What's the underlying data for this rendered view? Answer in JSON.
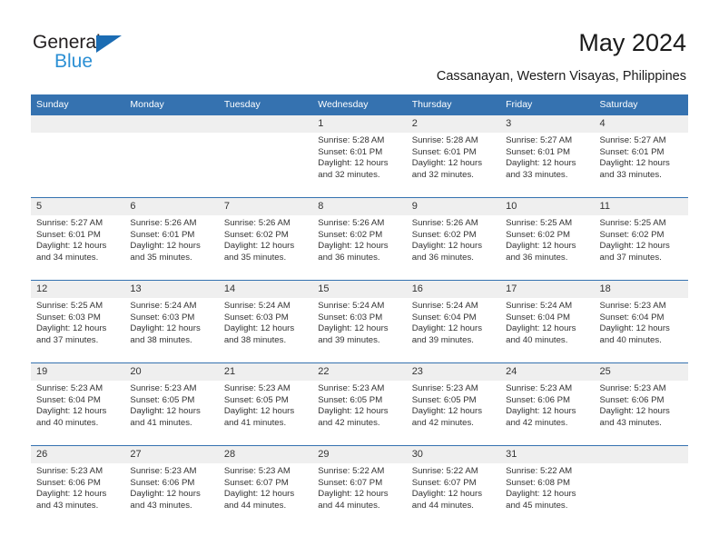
{
  "brand": {
    "name_top": "General",
    "name_bottom": "Blue",
    "accent_dark_blue": "#1b6cb3",
    "accent_light_blue": "#2b8fd4"
  },
  "header": {
    "title": "May 2024",
    "subtitle": "Cassanayan, Western Visayas, Philippines"
  },
  "theme": {
    "header_blue": "#3572b0",
    "daynum_gray": "#efefef",
    "text": "#333333"
  },
  "calendar": {
    "weekday_headers": [
      "Sunday",
      "Monday",
      "Tuesday",
      "Wednesday",
      "Thursday",
      "Friday",
      "Saturday"
    ],
    "weeks": [
      [
        {
          "day": "",
          "lines": []
        },
        {
          "day": "",
          "lines": []
        },
        {
          "day": "",
          "lines": []
        },
        {
          "day": "1",
          "lines": [
            "Sunrise: 5:28 AM",
            "Sunset: 6:01 PM",
            "Daylight: 12 hours",
            "and 32 minutes."
          ]
        },
        {
          "day": "2",
          "lines": [
            "Sunrise: 5:28 AM",
            "Sunset: 6:01 PM",
            "Daylight: 12 hours",
            "and 32 minutes."
          ]
        },
        {
          "day": "3",
          "lines": [
            "Sunrise: 5:27 AM",
            "Sunset: 6:01 PM",
            "Daylight: 12 hours",
            "and 33 minutes."
          ]
        },
        {
          "day": "4",
          "lines": [
            "Sunrise: 5:27 AM",
            "Sunset: 6:01 PM",
            "Daylight: 12 hours",
            "and 33 minutes."
          ]
        }
      ],
      [
        {
          "day": "5",
          "lines": [
            "Sunrise: 5:27 AM",
            "Sunset: 6:01 PM",
            "Daylight: 12 hours",
            "and 34 minutes."
          ]
        },
        {
          "day": "6",
          "lines": [
            "Sunrise: 5:26 AM",
            "Sunset: 6:01 PM",
            "Daylight: 12 hours",
            "and 35 minutes."
          ]
        },
        {
          "day": "7",
          "lines": [
            "Sunrise: 5:26 AM",
            "Sunset: 6:02 PM",
            "Daylight: 12 hours",
            "and 35 minutes."
          ]
        },
        {
          "day": "8",
          "lines": [
            "Sunrise: 5:26 AM",
            "Sunset: 6:02 PM",
            "Daylight: 12 hours",
            "and 36 minutes."
          ]
        },
        {
          "day": "9",
          "lines": [
            "Sunrise: 5:26 AM",
            "Sunset: 6:02 PM",
            "Daylight: 12 hours",
            "and 36 minutes."
          ]
        },
        {
          "day": "10",
          "lines": [
            "Sunrise: 5:25 AM",
            "Sunset: 6:02 PM",
            "Daylight: 12 hours",
            "and 36 minutes."
          ]
        },
        {
          "day": "11",
          "lines": [
            "Sunrise: 5:25 AM",
            "Sunset: 6:02 PM",
            "Daylight: 12 hours",
            "and 37 minutes."
          ]
        }
      ],
      [
        {
          "day": "12",
          "lines": [
            "Sunrise: 5:25 AM",
            "Sunset: 6:03 PM",
            "Daylight: 12 hours",
            "and 37 minutes."
          ]
        },
        {
          "day": "13",
          "lines": [
            "Sunrise: 5:24 AM",
            "Sunset: 6:03 PM",
            "Daylight: 12 hours",
            "and 38 minutes."
          ]
        },
        {
          "day": "14",
          "lines": [
            "Sunrise: 5:24 AM",
            "Sunset: 6:03 PM",
            "Daylight: 12 hours",
            "and 38 minutes."
          ]
        },
        {
          "day": "15",
          "lines": [
            "Sunrise: 5:24 AM",
            "Sunset: 6:03 PM",
            "Daylight: 12 hours",
            "and 39 minutes."
          ]
        },
        {
          "day": "16",
          "lines": [
            "Sunrise: 5:24 AM",
            "Sunset: 6:04 PM",
            "Daylight: 12 hours",
            "and 39 minutes."
          ]
        },
        {
          "day": "17",
          "lines": [
            "Sunrise: 5:24 AM",
            "Sunset: 6:04 PM",
            "Daylight: 12 hours",
            "and 40 minutes."
          ]
        },
        {
          "day": "18",
          "lines": [
            "Sunrise: 5:23 AM",
            "Sunset: 6:04 PM",
            "Daylight: 12 hours",
            "and 40 minutes."
          ]
        }
      ],
      [
        {
          "day": "19",
          "lines": [
            "Sunrise: 5:23 AM",
            "Sunset: 6:04 PM",
            "Daylight: 12 hours",
            "and 40 minutes."
          ]
        },
        {
          "day": "20",
          "lines": [
            "Sunrise: 5:23 AM",
            "Sunset: 6:05 PM",
            "Daylight: 12 hours",
            "and 41 minutes."
          ]
        },
        {
          "day": "21",
          "lines": [
            "Sunrise: 5:23 AM",
            "Sunset: 6:05 PM",
            "Daylight: 12 hours",
            "and 41 minutes."
          ]
        },
        {
          "day": "22",
          "lines": [
            "Sunrise: 5:23 AM",
            "Sunset: 6:05 PM",
            "Daylight: 12 hours",
            "and 42 minutes."
          ]
        },
        {
          "day": "23",
          "lines": [
            "Sunrise: 5:23 AM",
            "Sunset: 6:05 PM",
            "Daylight: 12 hours",
            "and 42 minutes."
          ]
        },
        {
          "day": "24",
          "lines": [
            "Sunrise: 5:23 AM",
            "Sunset: 6:06 PM",
            "Daylight: 12 hours",
            "and 42 minutes."
          ]
        },
        {
          "day": "25",
          "lines": [
            "Sunrise: 5:23 AM",
            "Sunset: 6:06 PM",
            "Daylight: 12 hours",
            "and 43 minutes."
          ]
        }
      ],
      [
        {
          "day": "26",
          "lines": [
            "Sunrise: 5:23 AM",
            "Sunset: 6:06 PM",
            "Daylight: 12 hours",
            "and 43 minutes."
          ]
        },
        {
          "day": "27",
          "lines": [
            "Sunrise: 5:23 AM",
            "Sunset: 6:06 PM",
            "Daylight: 12 hours",
            "and 43 minutes."
          ]
        },
        {
          "day": "28",
          "lines": [
            "Sunrise: 5:23 AM",
            "Sunset: 6:07 PM",
            "Daylight: 12 hours",
            "and 44 minutes."
          ]
        },
        {
          "day": "29",
          "lines": [
            "Sunrise: 5:22 AM",
            "Sunset: 6:07 PM",
            "Daylight: 12 hours",
            "and 44 minutes."
          ]
        },
        {
          "day": "30",
          "lines": [
            "Sunrise: 5:22 AM",
            "Sunset: 6:07 PM",
            "Daylight: 12 hours",
            "and 44 minutes."
          ]
        },
        {
          "day": "31",
          "lines": [
            "Sunrise: 5:22 AM",
            "Sunset: 6:08 PM",
            "Daylight: 12 hours",
            "and 45 minutes."
          ]
        },
        {
          "day": "",
          "lines": []
        }
      ]
    ]
  }
}
